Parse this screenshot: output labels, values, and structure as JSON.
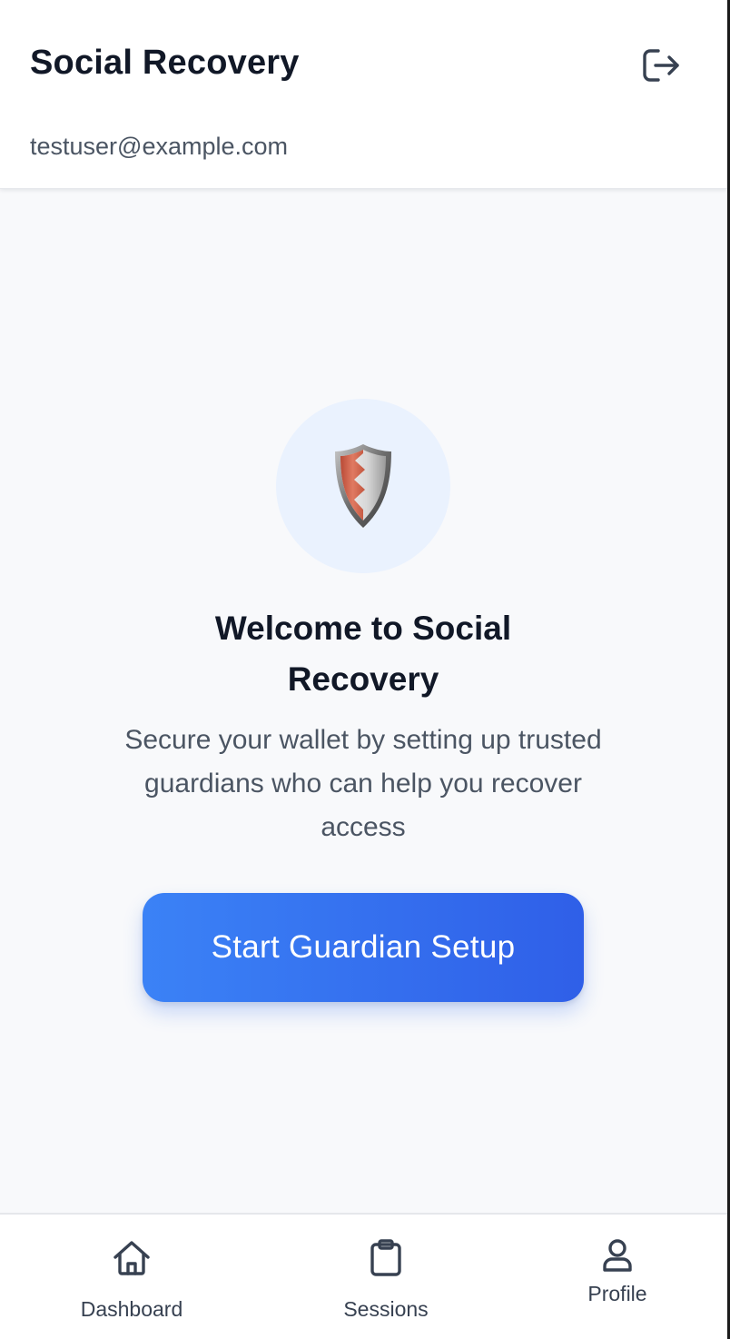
{
  "header": {
    "title": "Social Recovery",
    "user_email": "testuser@example.com",
    "logout_icon": "logout-icon"
  },
  "main": {
    "hero_icon": "shield-icon",
    "welcome_title": "Welcome to Social Recovery",
    "welcome_subtitle": "Secure your wallet by setting up trusted guardians who can help you recover access",
    "setup_button_label": "Start Guardian Setup"
  },
  "bottom_nav": {
    "items": [
      {
        "label": "Dashboard",
        "icon": "home-icon"
      },
      {
        "label": "Sessions",
        "icon": "clipboard-icon"
      },
      {
        "label": "Profile",
        "icon": "user-icon"
      }
    ]
  },
  "colors": {
    "accent_start": "#3b82f6",
    "accent_end": "#2f5fe8",
    "title_text": "#111827",
    "body_text": "#4b5563",
    "hero_circle": "#eaf2fe",
    "shield_red": "#d9604a"
  }
}
